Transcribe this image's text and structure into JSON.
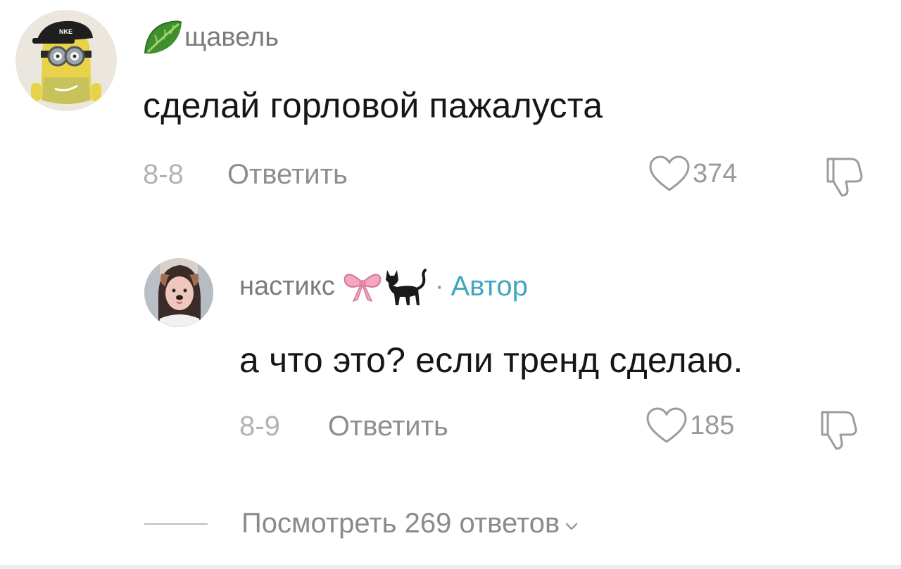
{
  "comments": [
    {
      "username": "щавель",
      "text": "сделай горловой пажалуста",
      "date": "8-8",
      "reply_label": "Ответить",
      "likes": "374",
      "username_icon": "lettuce-leaf-icon",
      "avatar_icon": "minion-avatar"
    },
    {
      "username": "настикс",
      "author_separator": "·",
      "author_badge": "Автор",
      "text": "а что это? если тренд сделаю.",
      "date": "8-9",
      "reply_label": "Ответить",
      "likes": "185",
      "username_emojis": [
        "pink-bow-icon",
        "black-cat-icon"
      ],
      "avatar_icon": "girl-dog-filter-avatar"
    }
  ],
  "view_replies": {
    "label": "Посмотреть 269 ответов",
    "chevron_icon": "chevron-down-icon"
  },
  "colors": {
    "author_badge": "#3fa7c2",
    "text": "#161616",
    "muted": "#8e8e8e"
  }
}
